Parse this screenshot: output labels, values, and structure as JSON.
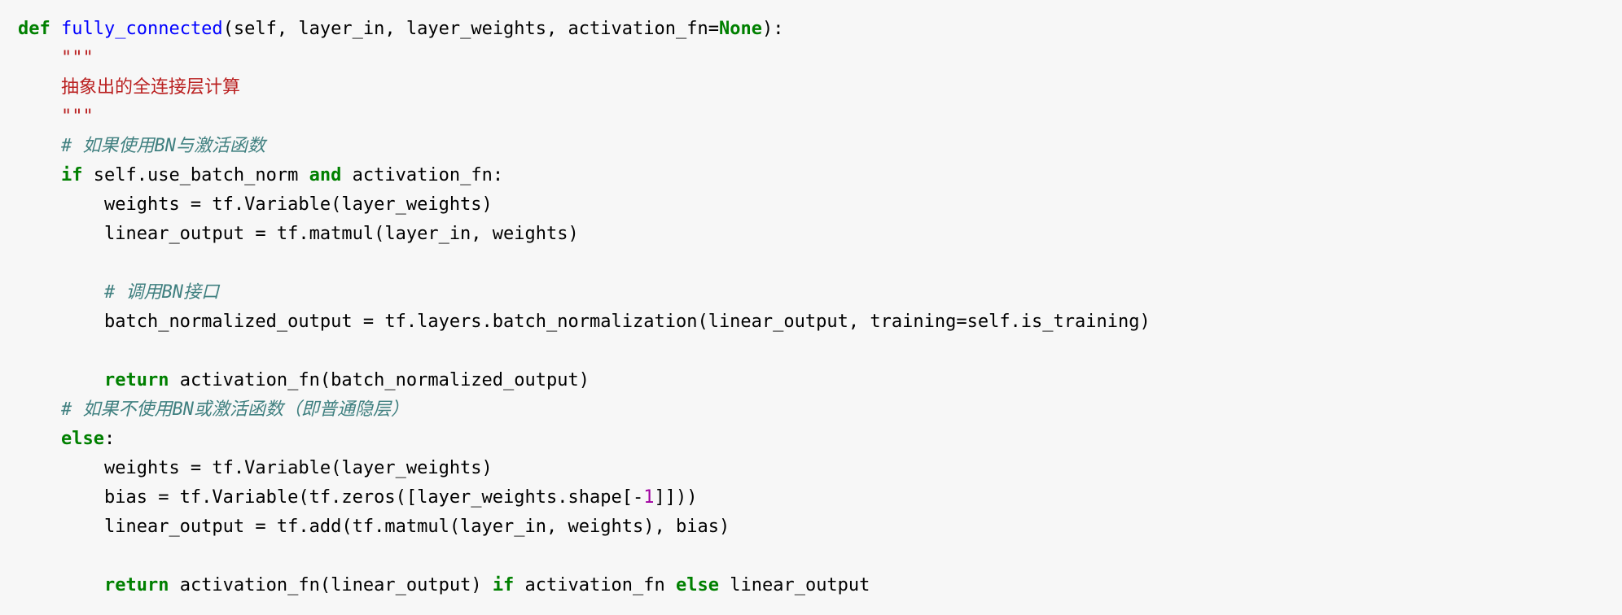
{
  "kw": {
    "def": "def",
    "if": "if",
    "and": "and",
    "return": "return",
    "else": "else",
    "none": "None"
  },
  "fn": {
    "name": "fully_connected"
  },
  "sig": {
    "open": "(self, layer_in, layer_weights, activation_fn=",
    "close": "):"
  },
  "doc": {
    "q1": "\"\"\"",
    "body": "抽象出的全连接层计算",
    "q2": "\"\"\""
  },
  "cmt": {
    "c1": "# 如果使用BN与激活函数",
    "c2": "# 调用BN接口",
    "c3": "# 如果不使用BN或激活函数（即普通隐层）"
  },
  "code": {
    "ifcond": " self.use_batch_norm ",
    "ifcond2": " activation_fn:",
    "w1": "weights = tf.Variable(layer_weights)",
    "lin1": "linear_output = tf.matmul(layer_in, weights)",
    "bn": "batch_normalized_output = tf.layers.batch_normalization(linear_output, training=self.is_training)",
    "ret1": " activation_fn(batch_normalized_output)",
    "elsecolon": ":",
    "w2": "weights = tf.Variable(layer_weights)",
    "bias_a": "bias = tf.Variable(tf.zeros([layer_weights.shape[",
    "neg1_a": "-",
    "neg1_b": "1",
    "bias_b": "]]))",
    "lin2": "linear_output = tf.add(tf.matmul(layer_in, weights), bias)",
    "ret2a": " activation_fn(linear_output) ",
    "ret2b": " activation_fn ",
    "ret2c": " linear_output"
  }
}
